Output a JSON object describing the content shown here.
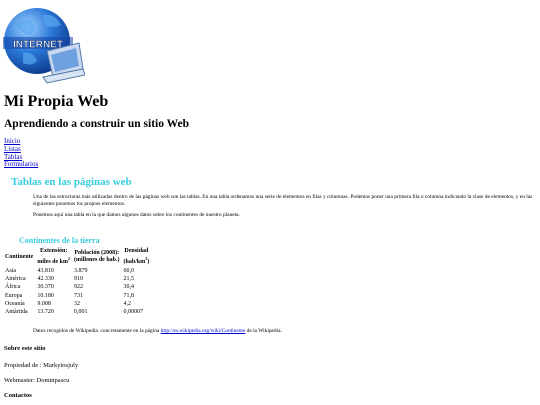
{
  "logo": {
    "text": "INTERNET"
  },
  "header": {
    "title": "Mi Propia Web",
    "subtitle": "Aprendiendo a construir un sitio Web"
  },
  "nav": {
    "items": [
      {
        "label": "Inicio"
      },
      {
        "label": "Listas"
      },
      {
        "label": "Tablas"
      },
      {
        "label": "Formularios"
      }
    ]
  },
  "section": {
    "title": "Tablas en las páginas web",
    "paragraph1": "Una de las estructuras más utilizadas dentro de las páginas web son las tablas. En una tabla ordenamos una serie de elementos en filas y columnas. Podemos poner una primera fila o columna indicando la clase de elementos, y en las siguientes ponemos los propios elementos.",
    "paragraph2": "Ponemos aquí una tabla en la que damos algunos datos sobre los continentes de nuestro planeta."
  },
  "table": {
    "title": "Continentes de la tierra",
    "headers": {
      "col1": "Continente",
      "col2_line1": "Extensión:",
      "col2_line2": "miles de km",
      "col2_sup": "2",
      "col3_line1": "Población (2008):",
      "col3_line2": "(millones de hab.)",
      "col4_line1": "Densidad",
      "col4_line2": "(hab/km",
      "col4_sup": "2",
      "col4_close": ")"
    },
    "rows": [
      {
        "continent": "Asia",
        "area": "43.810",
        "population": "3.879",
        "density": "60,0"
      },
      {
        "continent": "América",
        "area": "42.330",
        "population": "910",
        "density": "21,5"
      },
      {
        "continent": "África",
        "area": "30.370",
        "population": "922",
        "density": "30,4"
      },
      {
        "continent": "Europa",
        "area": "10.180",
        "population": "731",
        "density": "71,8"
      },
      {
        "continent": "Oceanía",
        "area": "9.008",
        "population": "32",
        "density": "4,2"
      },
      {
        "continent": "Antártida",
        "area": "13.720",
        "population": "0,001",
        "density": "0,00007"
      }
    ],
    "source_prefix": "Datos recogidos de Wikipedia. concretamente en la página ",
    "source_link": "http://es.wikipedia.org/wiki/Continente",
    "source_suffix": " de la Wikipedia."
  },
  "footer": {
    "about_title": "Sobre este sitio",
    "owner": "Propiedad de : Markytosjuly",
    "webmaster": "Webmaster: Dominpascu",
    "contacts_title": "Contactos"
  },
  "colors": {
    "accent": "#33ccdd",
    "link": "#0000cc",
    "globe": "#1e66c8"
  }
}
